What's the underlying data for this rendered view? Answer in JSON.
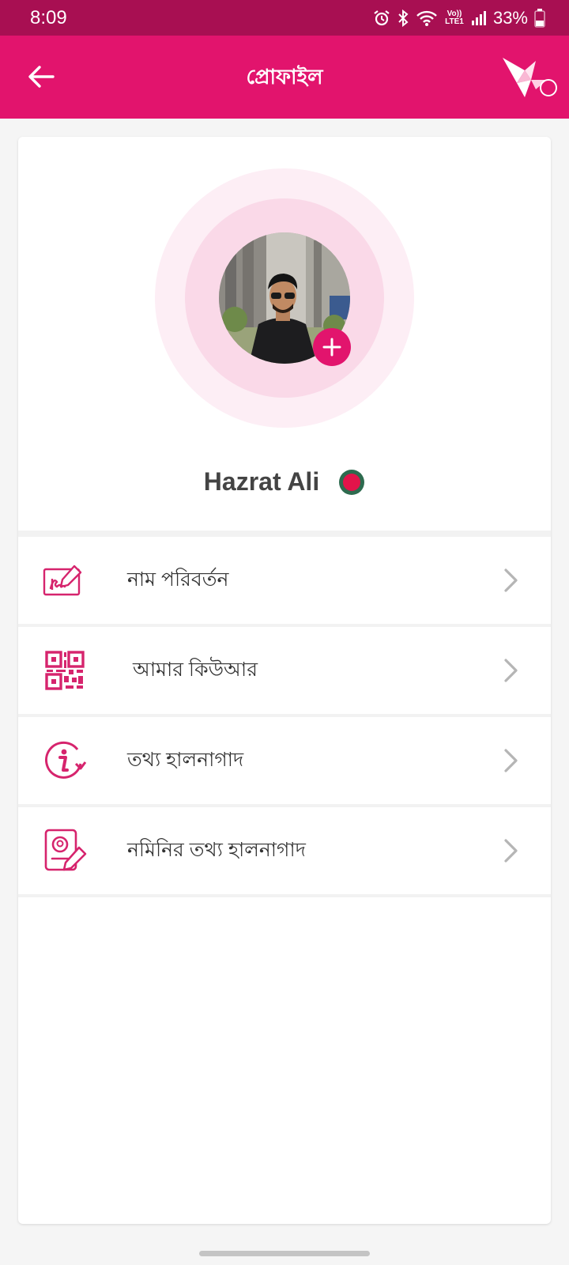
{
  "status_bar": {
    "time": "8:09",
    "battery": "33%",
    "network_label": "Vo)) LTE1",
    "icons": [
      "alarm-icon",
      "bluetooth-icon",
      "wifi-icon",
      "signal-icon",
      "battery-icon"
    ]
  },
  "app_bar": {
    "title": "প্রোফাইল",
    "back_icon": "back-arrow-icon",
    "logo": "paper-bird-logo"
  },
  "profile": {
    "name": "Hazrat Ali",
    "country_flag": "bangladesh-flag",
    "add_photo_icon": "plus-icon"
  },
  "menu": {
    "items": [
      {
        "label": "নাম পরিবর্তন",
        "icon": "signature-icon"
      },
      {
        "label": " আমার কিউআর",
        "icon": "qr-code-icon"
      },
      {
        "label": "তথ্য হালনাগাদ",
        "icon": "info-refresh-icon"
      },
      {
        "label": "নমিনির তথ্য হালনাগাদ",
        "icon": "nominee-edit-icon"
      }
    ]
  },
  "colors": {
    "primary": "#e2146d",
    "status_bar": "#a80f52",
    "ring_outer": "#fdeef5",
    "ring_inner": "#fad9e8",
    "flag_green": "#2e6b4f",
    "flag_red": "#e2144a"
  }
}
